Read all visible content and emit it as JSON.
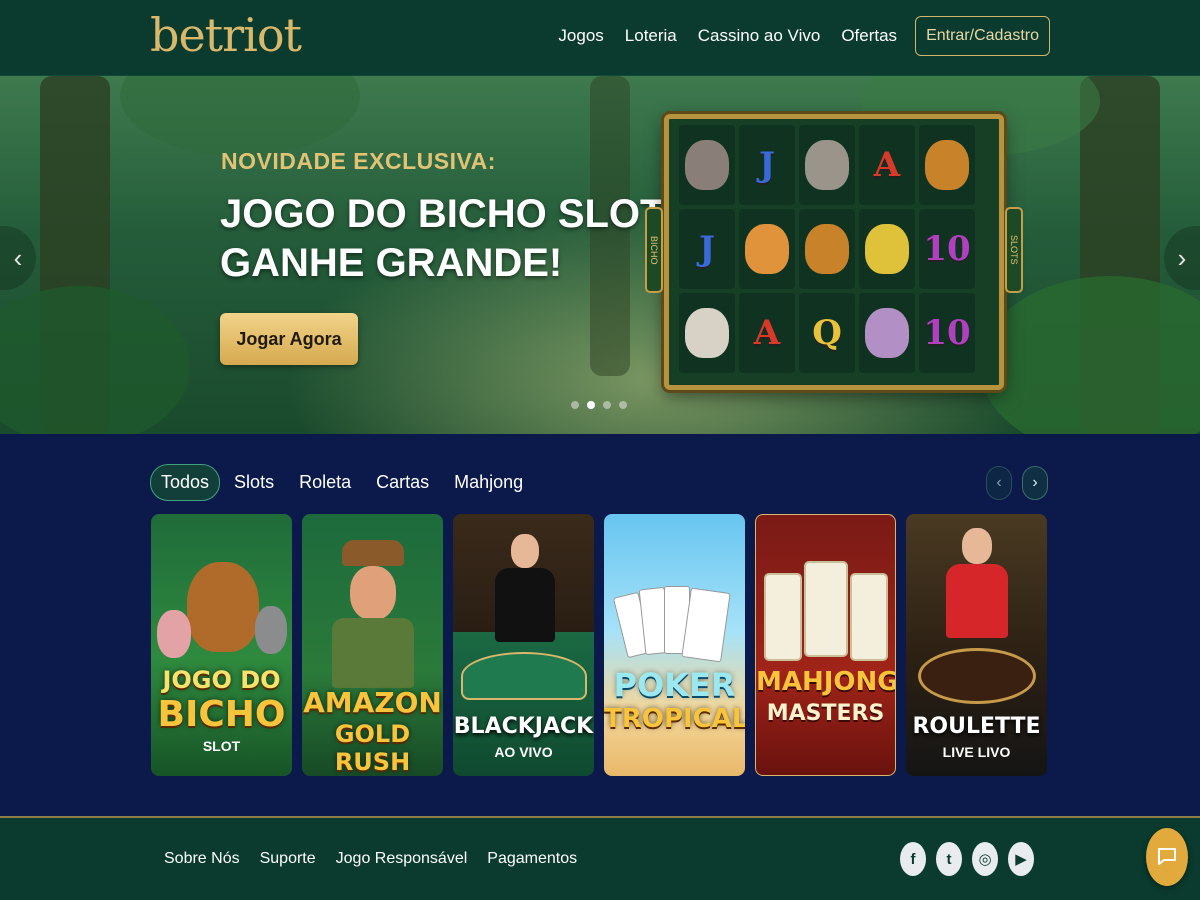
{
  "header": {
    "logo": "betriot",
    "nav": [
      "Jogos",
      "Loteria",
      "Cassino ao Vivo",
      "Ofertas"
    ],
    "login_button": "Entrar/Cadastro"
  },
  "hero": {
    "eyebrow": "NOVIDADE EXCLUSIVA:",
    "title_line1": "JOGO DO BICHO SLOT!",
    "title_line2": "GANHE GRANDE!",
    "cta": "Jogar Agora",
    "prev_icon": "‹",
    "next_icon": "›",
    "slides_count": 4,
    "active_slide": 2,
    "slot": {
      "side_left": "BICHO",
      "side_right": "SLOTS",
      "reels": [
        [
          "rhino",
          "J",
          "elephant",
          "A",
          "lion"
        ],
        [
          "J",
          "tiger",
          "lion",
          "parrot",
          "10"
        ],
        [
          "bear",
          "A",
          "Q",
          "pig",
          "10"
        ]
      ]
    }
  },
  "games": {
    "tabs": [
      "Todos",
      "Slots",
      "Roleta",
      "Cartas",
      "Mahjong"
    ],
    "active_tab": "Todos",
    "prev_icon": "‹",
    "next_icon": "›",
    "cards": [
      {
        "title_1": "JOGO DO",
        "title_2": "BICHO",
        "subtitle": "SLOT"
      },
      {
        "title_1": "AMAZON",
        "title_2": "GOLD RUSH",
        "subtitle": ""
      },
      {
        "title_1": "BLACKJACK",
        "title_2": "",
        "subtitle": "AO VIVO"
      },
      {
        "title_1": "POKER",
        "title_2": "TROPICAL",
        "subtitle": ""
      },
      {
        "title_1": "MAHJONG",
        "title_2": "MASTERS",
        "subtitle": ""
      },
      {
        "title_1": "ROULETTE",
        "title_2": "",
        "subtitle": "LIVE LIVO"
      }
    ]
  },
  "footer": {
    "links": [
      "Sobre Nós",
      "Suporte",
      "Jogo Responsável",
      "Pagamentos"
    ],
    "social": [
      {
        "name": "facebook-icon",
        "glyph": "f"
      },
      {
        "name": "twitter-icon",
        "glyph": "t"
      },
      {
        "name": "instagram-icon",
        "glyph": "◎"
      },
      {
        "name": "youtube-icon",
        "glyph": "▶"
      }
    ]
  },
  "colors": {
    "header_bg": "#0a3b2e",
    "accent_gold": "#d9b86c",
    "page_bg": "#0b1a4a",
    "chat_orange": "#e2a93c"
  }
}
